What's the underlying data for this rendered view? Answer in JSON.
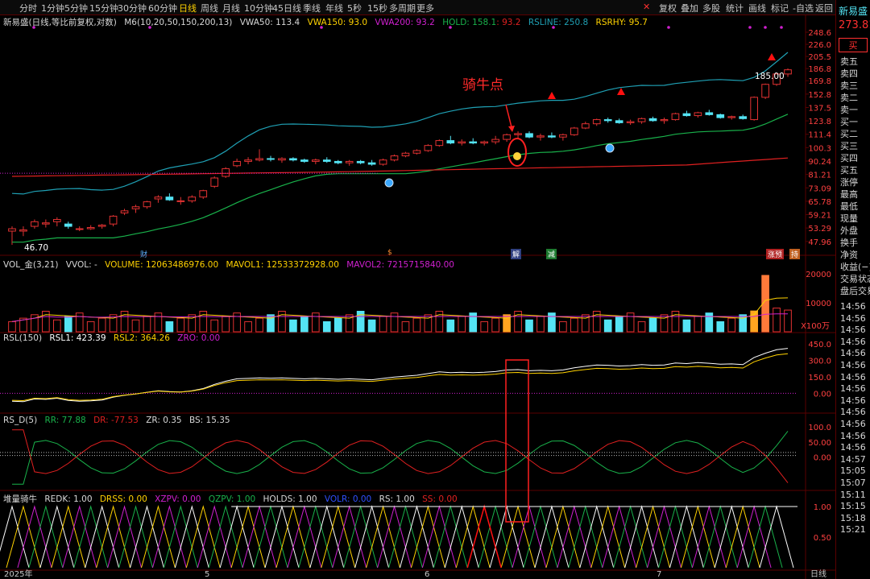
{
  "topbar": {
    "periods": [
      "分时",
      "1分钟",
      "5分钟",
      "15分钟",
      "30分钟",
      "60分钟",
      "日线",
      "周线",
      "月线",
      "10分钟",
      "45日线",
      "季线",
      "年线",
      "5秒",
      "15秒",
      "多周期",
      "更多"
    ],
    "active": "日线",
    "tools": [
      "复权",
      "叠加",
      "多股",
      "统计",
      "画线",
      "标记",
      "-自选",
      "返回"
    ]
  },
  "stock": {
    "name": "新易盛",
    "price": "273.81",
    "buy": "买"
  },
  "quote_panel": [
    "卖五",
    "卖四",
    "卖三",
    "卖二",
    "卖一",
    "买一",
    "买二",
    "买三",
    "买四",
    "买五",
    "涨停",
    "最高",
    "最低",
    "现量",
    "外盘",
    "换手",
    "净资",
    "收益(−)",
    "交易状态",
    "盘后交易"
  ],
  "times": [
    "14:56",
    "14:56",
    "14:56",
    "14:56",
    "14:56",
    "14:56",
    "14:56",
    "14:56",
    "14:56",
    "14:56",
    "14:56",
    "14:56",
    "14:56",
    "14:57",
    "15:05",
    "15:07",
    "15:11",
    "15:15",
    "15:18",
    "15:21"
  ],
  "legend_main": {
    "title": "新易盛(日线,等比前复权,对数)",
    "m6": "M6(10,20,50,150,200,13)",
    "vwa50": "VWA50: 113.4",
    "vwa150": "VWA150: 93.0",
    "vwa200": "VWA200: 93.2",
    "hold": "HOLD: 158.1",
    "hold2": ": 93.2",
    "rsline": "RSLINE: 250.8",
    "rsrhy": "RSRHY: 95.7"
  },
  "legend_vol": {
    "title": "VOL_金(3,21)",
    "vvol": "VVOL: -",
    "volume": "VOLUME: 12063486976.00",
    "mavol1": "MAVOL1: 12533372928.00",
    "mavol2": "MAVOL2: 7215715840.00"
  },
  "legend_rsl": {
    "title": "RSL(150)",
    "rsl1": "RSL1: 423.39",
    "rsl2": "RSL2: 364.26",
    "zro": "ZRO: 0.00"
  },
  "legend_rsd": {
    "title": "RS_D(5)",
    "rr": "RR: 77.88",
    "dr": "DR: -77.53",
    "zr": "ZR: 0.35",
    "bs": "BS: 15.35"
  },
  "legend_dl": {
    "title": "堆量骑牛",
    "redk": "REDK: 1.00",
    "drss": "DRSS: 0.00",
    "xzpv": "XZPV: 0.00",
    "qzpv": "QZPV: 1.00",
    "holds": "HOLDS: 1.00",
    "volr": "VOLR: 0.00",
    "rs": "RS: 1.00",
    "ss": "SS: 0.00"
  },
  "annotations": {
    "qiniu": "骑牛点",
    "high_label": "185.00",
    "low_label": "46.70",
    "vol_unit": "X100万"
  },
  "events": [
    "财",
    "$",
    "解",
    "减",
    "涨预",
    "持"
  ],
  "x_labels": [
    "2025年",
    "5",
    "6",
    "7",
    "日线"
  ],
  "price_ticks": [
    "248.6",
    "226.0",
    "205.5",
    "186.8",
    "169.8",
    "152.8",
    "137.5",
    "123.8",
    "111.4",
    "100.3",
    "90.24",
    "81.21",
    "73.09",
    "65.78",
    "59.21",
    "53.29",
    "47.96"
  ],
  "vol_ticks": [
    "20000",
    "10000"
  ],
  "rsl_ticks": [
    "450.0",
    "300.0",
    "150.0",
    "0.00"
  ],
  "rsd_ticks": [
    "100.0",
    "50.00",
    "0.00"
  ],
  "dl_ticks": [
    "1.00",
    "0.50"
  ],
  "chart_data": {
    "type": "candlestick",
    "title": "新易盛(日线,等比前复权,对数)",
    "log_scale": true,
    "y_range": [
      46.7,
      255
    ],
    "ohlc": [
      [
        52,
        54,
        46.7,
        53
      ],
      [
        52,
        54,
        50,
        52.5
      ],
      [
        54,
        57,
        53,
        56
      ],
      [
        55,
        57,
        53.5,
        55.5
      ],
      [
        56,
        58,
        54,
        57
      ],
      [
        55,
        56,
        53,
        54
      ],
      [
        53,
        54,
        52,
        53
      ],
      [
        53,
        54.5,
        52.5,
        53.5
      ],
      [
        54,
        55,
        53,
        54.5
      ],
      [
        55,
        59,
        54,
        58.5
      ],
      [
        60,
        62,
        59,
        61
      ],
      [
        62,
        64,
        60,
        63
      ],
      [
        63,
        66,
        62,
        65.5
      ],
      [
        67,
        69,
        65,
        68
      ],
      [
        68,
        70,
        66,
        66.5
      ],
      [
        66,
        68,
        64,
        66
      ],
      [
        66,
        69,
        65,
        68
      ],
      [
        68,
        72,
        67,
        71.5
      ],
      [
        74,
        80,
        73,
        79
      ],
      [
        80,
        86,
        79,
        85
      ],
      [
        87,
        92,
        86,
        90
      ],
      [
        90,
        93,
        88,
        91
      ],
      [
        91,
        99,
        90,
        92
      ],
      [
        92,
        94,
        90,
        91.5
      ],
      [
        91,
        93,
        89,
        92
      ],
      [
        92,
        93,
        90,
        91
      ],
      [
        91,
        92,
        89,
        90
      ],
      [
        90,
        92,
        88,
        91
      ],
      [
        91,
        93,
        89,
        90
      ],
      [
        90,
        91,
        88,
        89
      ],
      [
        89,
        91,
        87,
        90
      ],
      [
        90,
        91,
        88,
        89
      ],
      [
        89,
        91,
        87,
        88
      ],
      [
        88,
        92,
        87,
        91
      ],
      [
        91,
        95,
        90,
        94
      ],
      [
        94,
        97,
        93,
        96
      ],
      [
        96,
        99,
        95,
        98
      ],
      [
        98,
        103,
        97,
        102
      ],
      [
        102,
        107,
        101,
        106
      ],
      [
        106,
        110,
        103,
        104
      ],
      [
        104,
        107,
        102,
        105
      ],
      [
        105,
        108,
        103,
        104
      ],
      [
        104,
        106,
        102,
        105
      ],
      [
        105,
        110,
        103,
        107
      ],
      [
        107,
        112,
        105,
        111
      ],
      [
        111,
        114,
        108,
        112
      ],
      [
        112,
        114,
        108,
        109
      ],
      [
        109,
        112,
        106,
        110
      ],
      [
        110,
        113,
        108,
        109
      ],
      [
        109,
        112,
        106,
        111
      ],
      [
        111,
        118,
        110,
        117
      ],
      [
        117,
        123,
        116,
        121
      ],
      [
        121,
        126,
        119,
        125
      ],
      [
        125,
        127,
        122,
        124
      ],
      [
        124,
        126,
        121,
        122
      ],
      [
        122,
        125,
        120,
        123
      ],
      [
        123,
        127,
        121,
        126
      ],
      [
        126,
        128,
        123,
        124
      ],
      [
        124,
        127,
        121,
        125
      ],
      [
        125,
        132,
        124,
        131
      ],
      [
        131,
        134,
        128,
        129
      ],
      [
        129,
        133,
        127,
        132
      ],
      [
        132,
        135,
        129,
        130
      ],
      [
        130,
        131,
        126,
        127
      ],
      [
        127,
        129,
        125,
        128
      ],
      [
        128,
        130,
        125,
        126
      ],
      [
        125,
        150,
        124,
        149
      ],
      [
        149,
        166,
        147,
        165
      ],
      [
        165,
        180,
        163,
        179
      ],
      [
        179,
        187,
        175,
        185
      ]
    ],
    "series": [
      {
        "name": "RSLINE",
        "color": "#1fa0b4"
      },
      {
        "name": "HOLD",
        "color": "#19b24b"
      },
      {
        "name": "VWA",
        "color": "#e02020"
      }
    ],
    "volume_ticks": [
      20000,
      10000
    ],
    "volume_unit": "X100万"
  },
  "colors": {
    "up": "#e23232",
    "down": "#54e4f4",
    "bg": "#000000",
    "axis": "#5a0000",
    "rsline": "#1fa0b4",
    "hold": "#19b24b",
    "vwa": "#e02020",
    "yellow": "#ffd200",
    "magenta": "#d020d0",
    "white": "#ffffff"
  }
}
